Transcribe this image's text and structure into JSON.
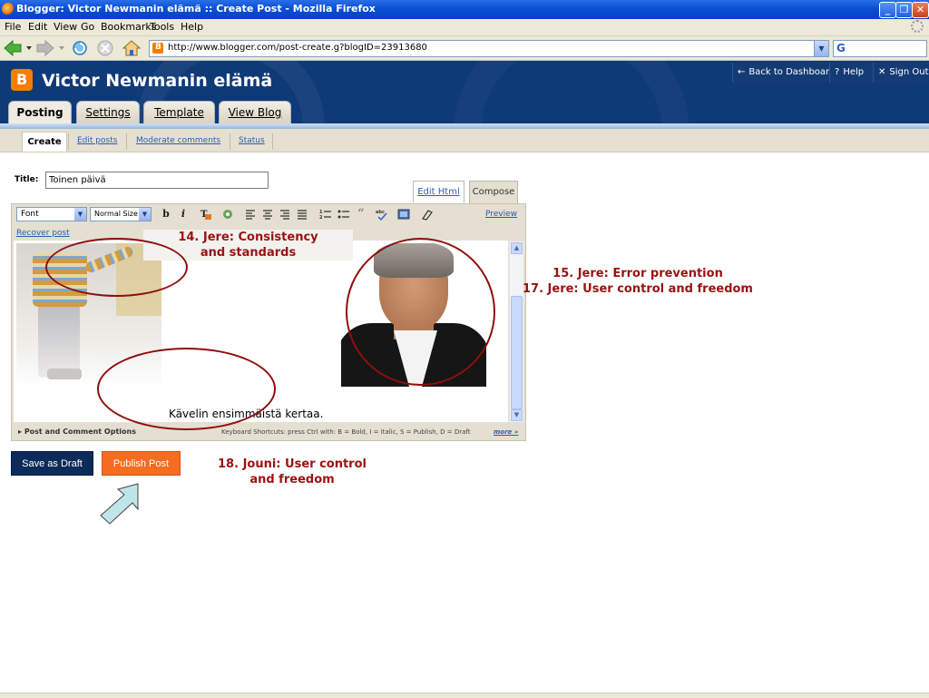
{
  "window": {
    "title": "Blogger: Victor Newmanin elämä :: Create Post - Mozilla Firefox",
    "controls": {
      "minimize": "_",
      "maximize": "❐",
      "close": "✕"
    }
  },
  "menubar": [
    "File",
    "Edit",
    "View",
    "Go",
    "Bookmarks",
    "Tools",
    "Help"
  ],
  "navigation": {
    "url": "http://www.blogger.com/post-create.g?blogID=23913680",
    "search_placeholder": "",
    "search_engine_glyph": "G"
  },
  "blog": {
    "name": "Victor Newmanin elämä",
    "top_links": [
      {
        "icon": "back-arrow-icon",
        "glyph": "←",
        "label": "Back to Dashboard"
      },
      {
        "icon": "help-icon",
        "glyph": "?",
        "label": "Help"
      },
      {
        "icon": "close-icon",
        "glyph": "✕",
        "label": "Sign Out"
      }
    ],
    "tabs": [
      "Posting",
      "Settings",
      "Template",
      "View Blog"
    ],
    "active_tab": "Posting",
    "subtabs": [
      "Create",
      "Edit posts",
      "Moderate comments",
      "Status"
    ],
    "active_subtab": "Create"
  },
  "editor": {
    "title_label": "Title:",
    "title_value": "Toinen päivä",
    "mode_tabs": {
      "edit_html": "Edit Html",
      "compose": "Compose"
    },
    "font_select": "Font",
    "size_select": "Normal Size",
    "toolbar_icons": [
      "bold-icon",
      "italic-icon",
      "text-color-icon",
      "link-icon",
      "align-left-icon",
      "align-center-icon",
      "align-right-icon",
      "justify-icon",
      "numbered-list-icon",
      "bullet-list-icon",
      "blockquote-icon",
      "spellcheck-icon",
      "image-icon",
      "clear-formatting-icon"
    ],
    "preview": "Preview",
    "recover_post": "Recover post",
    "body_text": "Kävelin ensimmäistä kertaa.",
    "post_options": "Post and Comment Options",
    "shortcuts": "Keyboard Shortcuts: press Ctrl with: B = Bold, I = Italic, S = Publish, D = Draft",
    "more": "more »"
  },
  "buttons": {
    "save_draft": "Save as Draft",
    "publish": "Publish Post"
  },
  "annotations": {
    "note14_line1": "14. Jere: Consistency",
    "note14_line2": "and standards",
    "note15_line1": "15. Jere: Error prevention",
    "note15_line2": "17. Jere: User control and freedom",
    "note18_line1": "18. Jouni: User control",
    "note18_line2": "and freedom"
  },
  "colors": {
    "header": "#0f3a78",
    "publish": "#f66d1f",
    "draft": "#0d2b5a",
    "annotation": "#9b1212"
  }
}
